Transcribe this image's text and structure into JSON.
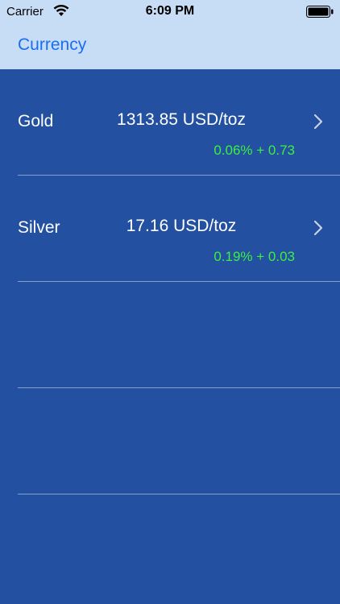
{
  "status": {
    "carrier": "Carrier",
    "time": "6:09 PM"
  },
  "nav": {
    "title": "Currency"
  },
  "rows": [
    {
      "name": "Gold",
      "price": "1313.85 USD/toz",
      "change": "0.06% + 0.73"
    },
    {
      "name": "Silver",
      "price": "17.16 USD/toz",
      "change": "0.19% + 0.03"
    },
    {
      "name": "",
      "price": "",
      "change": ""
    },
    {
      "name": "",
      "price": "",
      "change": ""
    }
  ],
  "colors": {
    "background": "#2350a0",
    "nav_background": "#c7dcf5",
    "nav_title": "#1a6ef0",
    "positive_change": "#3cf040"
  },
  "icons": {
    "wifi": "wifi-icon",
    "battery": "battery-icon",
    "row_chevron": "chevron-right-icon"
  }
}
